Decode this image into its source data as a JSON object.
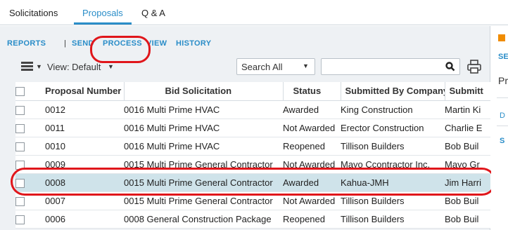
{
  "top_tabs": [
    "Solicitations",
    "Proposals",
    "Q & A"
  ],
  "active_tab": "Proposals",
  "actions": {
    "reports": "REPORTS",
    "separator": "|",
    "send": "SEND",
    "process": "PROCESS",
    "view": "VIEW",
    "history": "HISTORY"
  },
  "toolbar": {
    "view_label": "View: Default",
    "search_scope": "Search All",
    "search_value": ""
  },
  "table": {
    "columns": [
      "",
      "Proposal Number",
      "Bid Solicitation",
      "Status",
      "Submitted By Company",
      "Submitt"
    ],
    "rows": [
      {
        "number": "0012",
        "solicitation": "0016 Multi Prime HVAC",
        "status": "Awarded",
        "company": "King Construction",
        "submitted_by": "Martin Ki"
      },
      {
        "number": "0011",
        "solicitation": "0016 Multi Prime HVAC",
        "status": "Not Awarded",
        "company": "Erector Construction",
        "submitted_by": "Charlie E"
      },
      {
        "number": "0010",
        "solicitation": "0016 Multi Prime HVAC",
        "status": "Reopened",
        "company": "Tillison Builders",
        "submitted_by": "Bob Buil"
      },
      {
        "number": "0009",
        "solicitation": "0015 Multi Prime General Contractor",
        "status": "Not Awarded",
        "company": "Mayo Ccontractor Inc.",
        "submitted_by": "Mayo Gr"
      },
      {
        "number": "0008",
        "solicitation": "0015 Multi Prime General Contractor",
        "status": "Awarded",
        "company": "Kahua-JMH",
        "submitted_by": "Jim Harri"
      },
      {
        "number": "0007",
        "solicitation": "0015 Multi Prime General Contractor",
        "status": "Not Awarded",
        "company": "Tillison Builders",
        "submitted_by": "Bob Buil"
      },
      {
        "number": "0006",
        "solicitation": "0008 General Construction Package",
        "status": "Reopened",
        "company": "Tillison Builders",
        "submitted_by": "Bob Buil"
      }
    ]
  },
  "right_panel": {
    "label_se": "SE",
    "label_pr": "Pr",
    "label_d": "D",
    "label_s": "S"
  },
  "colors": {
    "accent": "#2a8dc8",
    "highlight": "#e0161b",
    "selected_row": "#cfe3ea"
  }
}
